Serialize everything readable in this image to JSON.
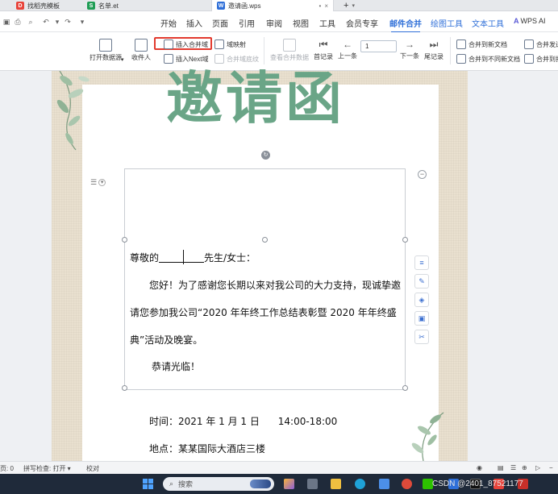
{
  "tabs": [
    {
      "label": "找稻壳模板",
      "icon_color": "#e8433a",
      "icon_letter": "D"
    },
    {
      "label": "名单.et",
      "icon_color": "#1f9d55",
      "icon_letter": "S"
    },
    {
      "label": "邀请函.wps",
      "icon_color": "#2f6fd8",
      "icon_letter": "W"
    }
  ],
  "new_tab": "+",
  "menu": {
    "items": [
      "开始",
      "插入",
      "页面",
      "引用",
      "审阅",
      "视图",
      "工具",
      "会员专享",
      "邮件合并",
      "绘图工具",
      "文本工具",
      "WPS AI"
    ],
    "active": "邮件合并"
  },
  "ribbon": {
    "open_source": "打开数据源",
    "recipients": "收件人",
    "insert_merge_field": "插入合并域",
    "field_mapping": "域映射",
    "insert_next": "插入Next域",
    "merge_shading": "合并域底纹",
    "view_merge_data": "查看合并数据",
    "first_record": "首记录",
    "prev": "上一条",
    "record_value": "1",
    "next": "下一条",
    "last_record": "尾记录",
    "merge_new_doc": "合并到新文档",
    "merge_diff_doc": "合并到不同新文档",
    "merge_send": "合并发送",
    "merge_print": "合并到打"
  },
  "document": {
    "title": "邀请函",
    "greeting_pre": "尊敬的",
    "greeting_post": "先生/女士：",
    "body_line1": "您好！为了感谢您长期以来对我公司的大力支持，现诚挚邀",
    "body_line2": "请您参加我公司“2020 年年终工作总结表彰暨 2020 年年终盛",
    "body_line3": "典”活动及晚宴。",
    "closing": "恭请光临！",
    "time": "时间：2021 年 1 月 1 日      14:00-18:00",
    "place": "地点：某某国际大酒店三楼"
  },
  "status": {
    "page": "页: 0",
    "spell": "拼写检查: 打开",
    "proof": "校对"
  },
  "taskbar": {
    "search_placeholder": "搜索",
    "watermark": "CSDN @2401_87521177"
  },
  "colors": {
    "accent": "#2f6fd8",
    "title_green": "#6aa587",
    "highlight_red": "#e23a2e"
  }
}
